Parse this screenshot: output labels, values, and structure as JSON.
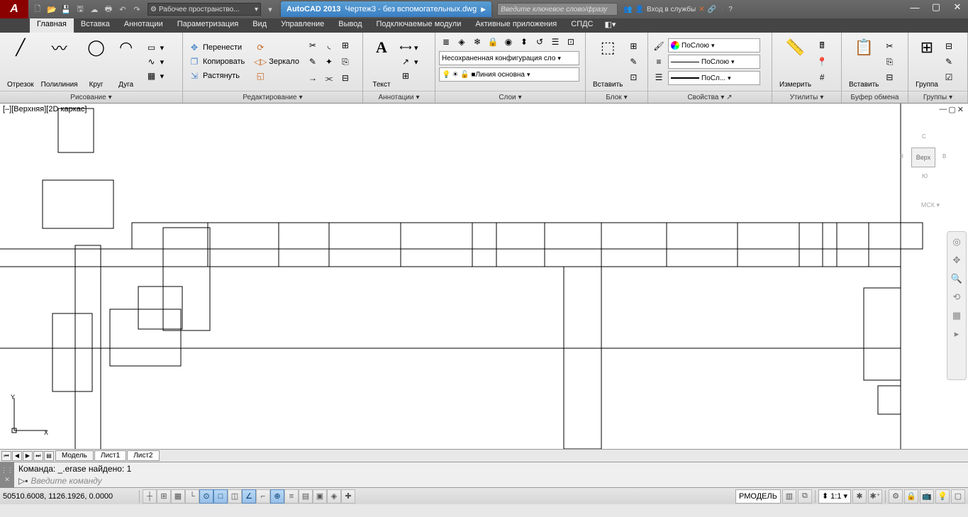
{
  "title": {
    "app": "AutoCAD 2013",
    "doc": "Чертеж3 - без вспомогательных.dwg"
  },
  "workspace": {
    "label": "Рабочее пространство..."
  },
  "search": {
    "placeholder": "Введите ключевое слово/фразу"
  },
  "signin": {
    "label": "Вход в службы"
  },
  "tabs": {
    "t0": "Главная",
    "t1": "Вставка",
    "t2": "Аннотации",
    "t3": "Параметризация",
    "t4": "Вид",
    "t5": "Управление",
    "t6": "Вывод",
    "t7": "Подключаемые модули",
    "t8": "Активные приложения",
    "t9": "СПДС"
  },
  "ribbon": {
    "draw": {
      "title": "Рисование",
      "line": "Отрезок",
      "polyline": "Полилиния",
      "circle": "Круг",
      "arc": "Дуга"
    },
    "modify": {
      "title": "Редактирование",
      "move": "Перенести",
      "copy": "Копировать",
      "stretch": "Растянуть",
      "rotate": "Поворот",
      "mirror": "Зеркало",
      "scale": "Масштаб"
    },
    "annot": {
      "title": "Аннотации",
      "text": "Текст"
    },
    "layers": {
      "title": "Слои",
      "unsaved": "Несохраненная конфигурация сло",
      "current": "Линия основна"
    },
    "block": {
      "title": "Блок",
      "insert": "Вставить"
    },
    "props": {
      "title": "Свойства",
      "color": "ПоСлою",
      "ltype": "ПоСлою",
      "lweight": "ПоСл..."
    },
    "util": {
      "title": "Утилиты",
      "measure": "Измерить"
    },
    "clip": {
      "title": "Буфер обмена",
      "paste": "Вставить"
    },
    "group": {
      "title": "Группы",
      "group": "Группа"
    }
  },
  "viewport": {
    "label": "[–][Верхняя][2D каркас]",
    "cube": "Верх",
    "wcs": "МСК"
  },
  "vc": {
    "n": "С",
    "s": "Ю",
    "e": "В",
    "w": "З"
  },
  "layout": {
    "model": "Модель",
    "l1": "Лист1",
    "l2": "Лист2"
  },
  "cmd": {
    "hist": "Команда: _.erase найдено: 1",
    "prompt_prefix": "▷▪",
    "prompt": "Введите команду"
  },
  "status": {
    "coords": "50510.6008, 1126.1926, 0.0000",
    "space": "РМОДЕЛЬ",
    "scale": "1:1"
  }
}
